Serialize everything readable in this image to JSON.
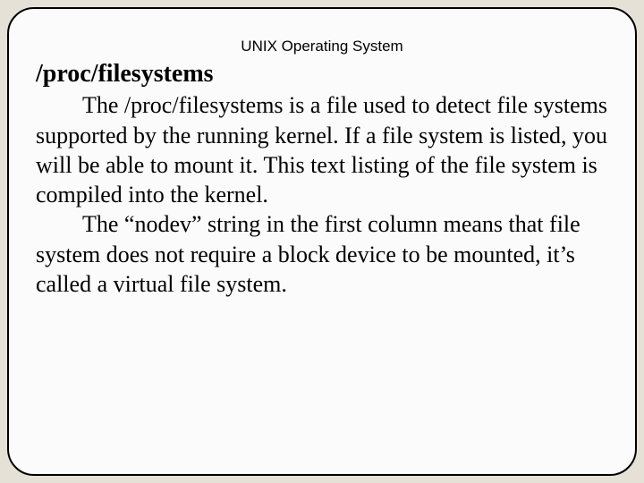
{
  "topic": "UNIX Operating System",
  "heading": "/proc/filesystems",
  "para1": "The /proc/filesystems is a file used to detect file systems supported by the running kernel. If a file system is listed, you will be able to mount it. This text listing of the file system is compiled into the kernel.",
  "para2": "The “nodev” string in the first column means that file system does not require a block device to be mounted, it’s called a virtual file system."
}
